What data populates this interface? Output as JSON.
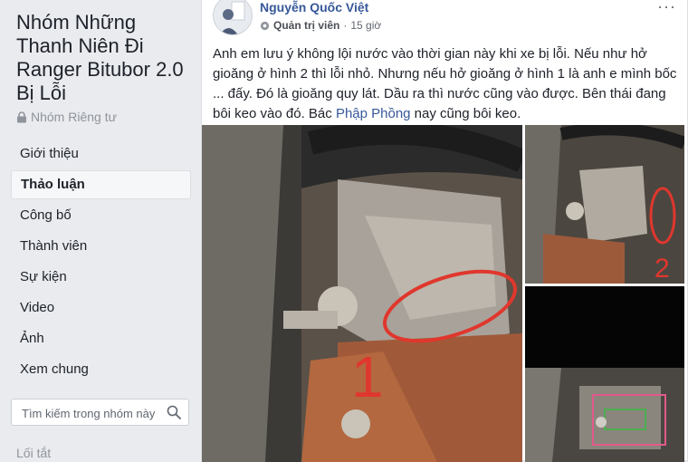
{
  "sidebar": {
    "group_title": "Nhóm Những Thanh Niên Đi Ranger Bitubor 2.0 Bị Lỗi",
    "privacy": "Nhóm Riêng tư",
    "nav": [
      {
        "label": "Giới thiệu",
        "active": false
      },
      {
        "label": "Thảo luận",
        "active": true
      },
      {
        "label": "Công bố",
        "active": false
      },
      {
        "label": "Thành viên",
        "active": false
      },
      {
        "label": "Sự kiện",
        "active": false
      },
      {
        "label": "Video",
        "active": false
      },
      {
        "label": "Ảnh",
        "active": false
      },
      {
        "label": "Xem chung",
        "active": false
      }
    ],
    "search_placeholder": "Tìm kiếm trong nhóm này",
    "shortcuts_label": "Lối tắt"
  },
  "post": {
    "author": "Nguyễn Quốc Việt",
    "role": "Quản trị viên",
    "separator": "·",
    "time": "15 giờ",
    "more_label": "···",
    "text_before": "Anh em lưu ý không lội nước vào thời gian này khi xe bị lỗi. Nếu như hở gioăng ở hình 2 thì lỗi nhỏ. Nhưng nếu hở gioăng ở hình 1 là anh e mình bốc ... đấy. Đó là gioăng quy lát. Dầu ra thì nước cũng vào được. Bên thái đang bôi keo vào đó. Bác ",
    "mention": "Phập Phồng",
    "text_after": " nay cũng bôi keo.",
    "photo_annotations": [
      "1",
      "2"
    ]
  },
  "colors": {
    "link": "#365899",
    "annotation_red": "#e0372d",
    "background": "#e9ebee"
  }
}
